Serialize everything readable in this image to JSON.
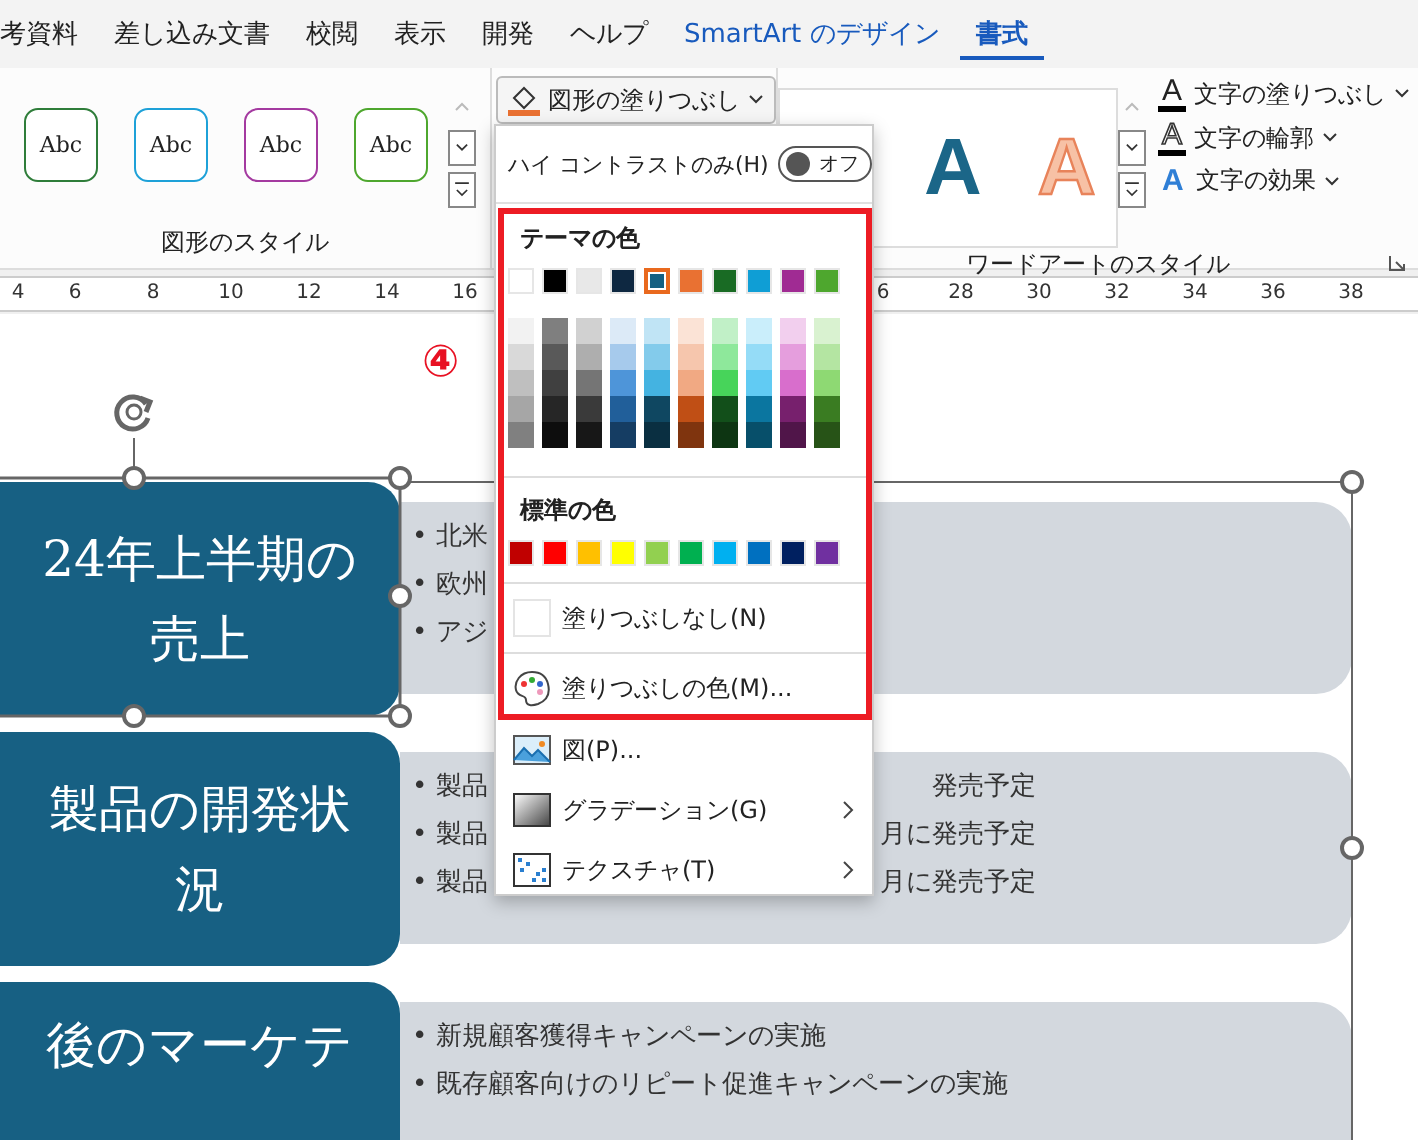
{
  "ribbon_tabs": [
    {
      "label": "考資料",
      "selected": false,
      "kind": "normal"
    },
    {
      "label": "差し込み文書",
      "selected": false,
      "kind": "normal"
    },
    {
      "label": "校閲",
      "selected": false,
      "kind": "normal"
    },
    {
      "label": "表示",
      "selected": false,
      "kind": "normal"
    },
    {
      "label": "開発",
      "selected": false,
      "kind": "normal"
    },
    {
      "label": "ヘルプ",
      "selected": false,
      "kind": "normal"
    },
    {
      "label": "SmartArt のデザイン",
      "selected": false,
      "kind": "contextual"
    },
    {
      "label": "書式",
      "selected": true,
      "kind": "contextual"
    }
  ],
  "shape_styles": {
    "label": "図形のスタイル",
    "presets": [
      {
        "text": "Abc",
        "color": "#2f7d3a"
      },
      {
        "text": "Abc",
        "color": "#1ea1d8"
      },
      {
        "text": "Abc",
        "color": "#a43aa0"
      },
      {
        "text": "Abc",
        "color": "#4ea72e"
      }
    ]
  },
  "fill_button": {
    "label": "図形の塗りつぶし"
  },
  "wordart_styles": {
    "label": "ワードアートのスタイル",
    "presets": [
      {
        "text": "A",
        "kind": "solid",
        "color": "#1b6688"
      },
      {
        "text": "A",
        "kind": "outline",
        "color": "#f7c1a5"
      }
    ]
  },
  "text_commands": [
    {
      "glyph": "A",
      "label": "文字の塗りつぶし",
      "kind": "fill"
    },
    {
      "glyph": "A",
      "label": "文字の輪郭",
      "kind": "outline"
    },
    {
      "glyph": "A",
      "label": "文字の効果",
      "kind": "effects"
    }
  ],
  "ruler": {
    "left_numbers": [
      "4",
      "6",
      "8",
      "10",
      "12",
      "14",
      "16"
    ],
    "right_numbers": [
      "6",
      "28",
      "30",
      "32",
      "34",
      "36",
      "38"
    ]
  },
  "annotation": "④",
  "slide_rows": [
    {
      "title_lines": [
        "24年上半期の",
        "売上"
      ],
      "bullets": [
        {
          "text": "• 北米"
        },
        {
          "text": "• 欧州"
        },
        {
          "text": "• アジ"
        }
      ]
    },
    {
      "title_lines": [
        "製品の開発状",
        "況"
      ],
      "bullets": [
        {
          "text": "• 製品",
          "tail": "発売予定"
        },
        {
          "text": "• 製品",
          "tail": "月に発売予定"
        },
        {
          "text": "• 製品",
          "tail": "月に発売予定"
        }
      ]
    },
    {
      "title_lines": [
        "後のマーケテ"
      ],
      "bullets": [
        {
          "text": "• 新規顧客獲得キャンペーンの実施"
        },
        {
          "text": "• 既存顧客向けのリピート促進キャンペーンの実施"
        }
      ]
    }
  ],
  "fill_menu": {
    "high_contrast": {
      "label": "ハイ コントラストのみ(H)",
      "on": false,
      "state_label": "オフ"
    },
    "theme_heading": "テーマの色",
    "theme_colors": [
      {
        "color": "#ffffff",
        "selected": false,
        "shades": [
          {
            "color": "#f2f2f2"
          },
          {
            "color": "#d9d9d9"
          },
          {
            "color": "#bfbfbf"
          },
          {
            "color": "#a6a6a6"
          },
          {
            "color": "#808080"
          }
        ]
      },
      {
        "color": "#000000",
        "selected": false,
        "shades": [
          {
            "color": "#7f7f7f"
          },
          {
            "color": "#595959"
          },
          {
            "color": "#404040"
          },
          {
            "color": "#262626"
          },
          {
            "color": "#0d0d0d"
          }
        ]
      },
      {
        "color": "#e8e8e8",
        "selected": false,
        "shades": [
          {
            "color": "#d1d1d1"
          },
          {
            "color": "#aeaeae"
          },
          {
            "color": "#757575"
          },
          {
            "color": "#3a3a3a"
          },
          {
            "color": "#171717"
          }
        ]
      },
      {
        "color": "#0e2841",
        "selected": false,
        "shades": [
          {
            "color": "#dceaf7"
          },
          {
            "color": "#a6caec"
          },
          {
            "color": "#4e95d9"
          },
          {
            "color": "#215f9a"
          },
          {
            "color": "#153d63"
          }
        ]
      },
      {
        "color": "#156082",
        "selected": true,
        "shades": [
          {
            "color": "#c0e4f5"
          },
          {
            "color": "#83cbeb"
          },
          {
            "color": "#44b3e1"
          },
          {
            "color": "#0f4761"
          },
          {
            "color": "#0a2f41"
          }
        ]
      },
      {
        "color": "#e97132",
        "selected": false,
        "shades": [
          {
            "color": "#fbe3d6"
          },
          {
            "color": "#f6c6ad"
          },
          {
            "color": "#f1a983"
          },
          {
            "color": "#c04f15"
          },
          {
            "color": "#7f340e"
          }
        ]
      },
      {
        "color": "#196b24",
        "selected": false,
        "shades": [
          {
            "color": "#c1f0c7"
          },
          {
            "color": "#8ee89b"
          },
          {
            "color": "#47d45a"
          },
          {
            "color": "#124f1a"
          },
          {
            "color": "#0d3512"
          }
        ]
      },
      {
        "color": "#0f9ed5",
        "selected": false,
        "shades": [
          {
            "color": "#caeefb"
          },
          {
            "color": "#95dcf7"
          },
          {
            "color": "#61cbf3"
          },
          {
            "color": "#0b76a0"
          },
          {
            "color": "#074f6a"
          }
        ]
      },
      {
        "color": "#a02b93",
        "selected": false,
        "shades": [
          {
            "color": "#f2cfee"
          },
          {
            "color": "#e59edd"
          },
          {
            "color": "#d86ecc"
          },
          {
            "color": "#77206d"
          },
          {
            "color": "#501549"
          }
        ]
      },
      {
        "color": "#4ea72e",
        "selected": false,
        "shades": [
          {
            "color": "#d9f2d0"
          },
          {
            "color": "#b4e5a2"
          },
          {
            "color": "#8ed973"
          },
          {
            "color": "#3a7c22"
          },
          {
            "color": "#275317"
          }
        ]
      }
    ],
    "standard_heading": "標準の色",
    "standard_colors": [
      {
        "color": "#c00000"
      },
      {
        "color": "#ff0000"
      },
      {
        "color": "#ffc000"
      },
      {
        "color": "#ffff00"
      },
      {
        "color": "#92d050"
      },
      {
        "color": "#00b050"
      },
      {
        "color": "#00b0f0"
      },
      {
        "color": "#0070c0"
      },
      {
        "color": "#002060"
      },
      {
        "color": "#7030a0"
      }
    ],
    "items": [
      {
        "label": "塗りつぶしなし(N)",
        "kind": "no-fill",
        "submenu": false
      },
      {
        "label": "塗りつぶしの色(M)...",
        "kind": "more-colors",
        "submenu": false
      },
      {
        "label": "図(P)...",
        "kind": "picture",
        "submenu": false
      },
      {
        "label": "グラデーション(G)",
        "kind": "gradient",
        "submenu": true
      },
      {
        "label": "テクスチャ(T)",
        "kind": "texture",
        "submenu": true
      }
    ]
  }
}
